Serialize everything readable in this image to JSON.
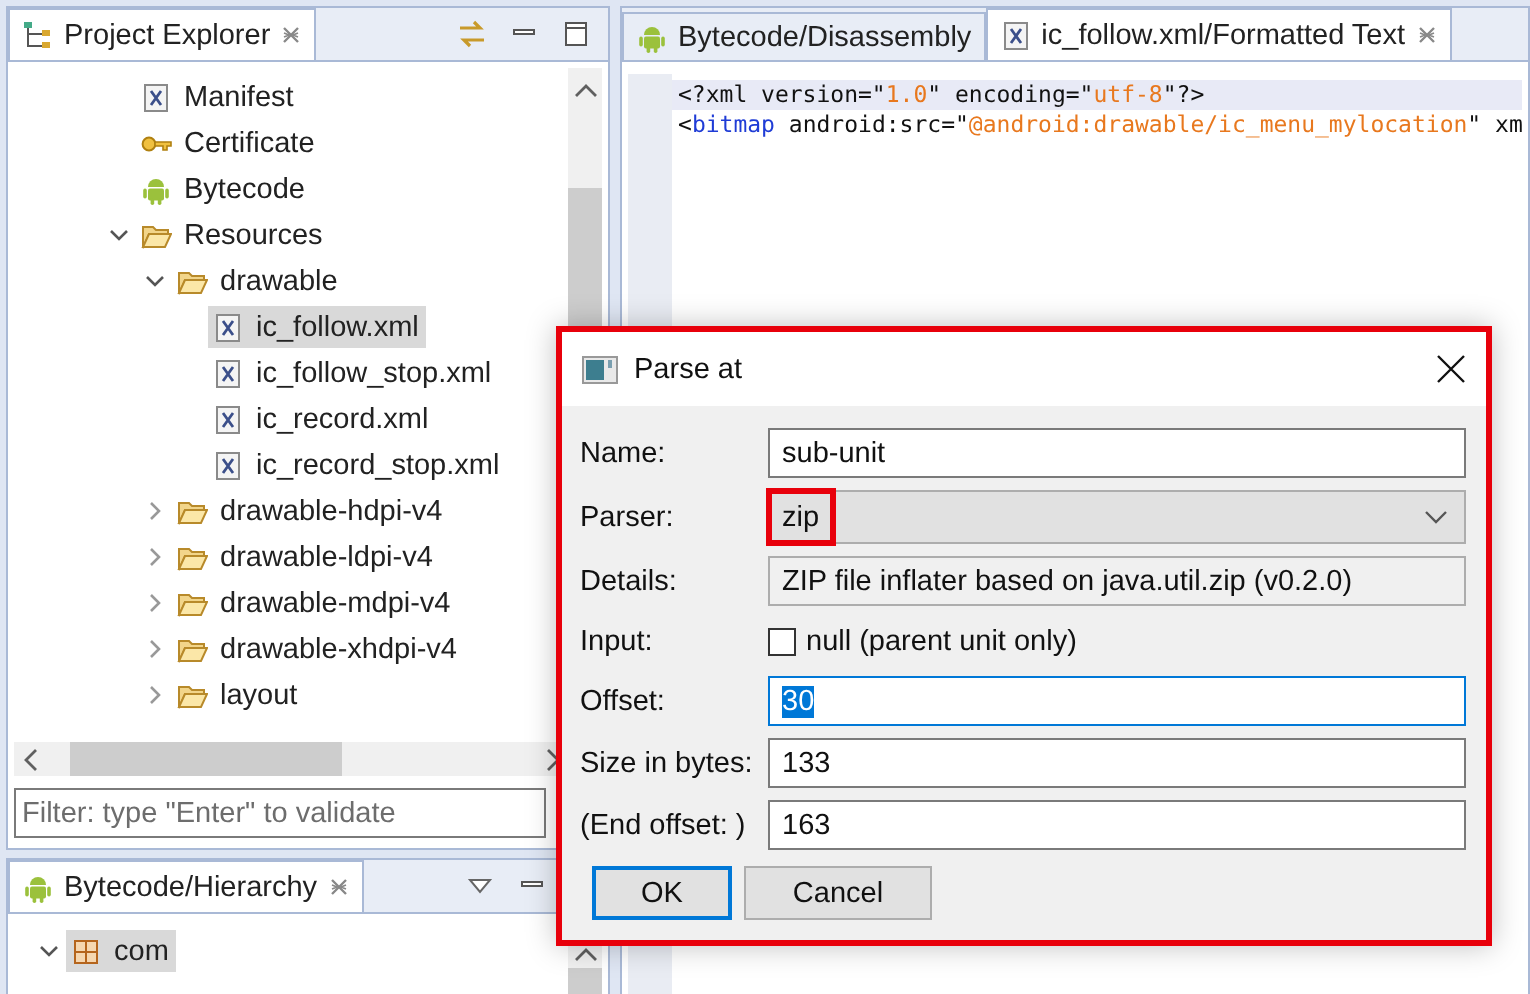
{
  "project_explorer": {
    "title": "Project Explorer",
    "tree": [
      {
        "label": "Manifest",
        "kind": "xml",
        "selected": false
      },
      {
        "label": "Certificate",
        "kind": "key",
        "selected": false
      },
      {
        "label": "Bytecode",
        "kind": "android",
        "selected": false
      },
      {
        "label": "Resources",
        "kind": "folder",
        "selected": false,
        "expanded": true,
        "children": [
          {
            "label": "drawable",
            "kind": "folder",
            "selected": false,
            "expanded": true,
            "children": [
              {
                "label": "ic_follow.xml",
                "kind": "xml",
                "selected": true
              },
              {
                "label": "ic_follow_stop.xml",
                "kind": "xml",
                "selected": false
              },
              {
                "label": "ic_record.xml",
                "kind": "xml",
                "selected": false
              },
              {
                "label": "ic_record_stop.xml",
                "kind": "xml",
                "selected": false
              }
            ]
          },
          {
            "label": "drawable-hdpi-v4",
            "kind": "folder",
            "selected": false,
            "expanded": false
          },
          {
            "label": "drawable-ldpi-v4",
            "kind": "folder",
            "selected": false,
            "expanded": false
          },
          {
            "label": "drawable-mdpi-v4",
            "kind": "folder",
            "selected": false,
            "expanded": false
          },
          {
            "label": "drawable-xhdpi-v4",
            "kind": "folder",
            "selected": false,
            "expanded": false
          },
          {
            "label": "layout",
            "kind": "folder",
            "selected": false,
            "expanded": false
          }
        ]
      }
    ],
    "filter": {
      "placeholder": "Filter: type \"Enter\" to validate"
    }
  },
  "hierarchy": {
    "title": "Bytecode/Hierarchy",
    "tree": [
      {
        "label": "com",
        "kind": "package",
        "selected": true,
        "expanded": true
      }
    ]
  },
  "editor": {
    "tabs": [
      {
        "label": "Bytecode/Disassembly",
        "kind": "android",
        "selected": false
      },
      {
        "label": "ic_follow.xml/Formatted Text",
        "kind": "xml",
        "selected": true
      }
    ],
    "lines": [
      {
        "current": true,
        "tokens": [
          {
            "kind": "plain",
            "text": "<?xml version=\""
          },
          {
            "kind": "string",
            "text": "1.0"
          },
          {
            "kind": "plain",
            "text": "\" encoding=\""
          },
          {
            "kind": "string",
            "text": "utf-8"
          },
          {
            "kind": "plain",
            "text": "\"?>"
          }
        ]
      },
      {
        "current": false,
        "tokens": [
          {
            "kind": "plain",
            "text": "<"
          },
          {
            "kind": "tag",
            "text": "bitmap"
          },
          {
            "kind": "plain",
            "text": " android:src=\""
          },
          {
            "kind": "string",
            "text": "@android:drawable/ic_menu_mylocation"
          },
          {
            "kind": "plain",
            "text": "\" xm"
          }
        ]
      }
    ]
  },
  "dialog": {
    "title": "Parse at",
    "rows": [
      {
        "label": "Name:",
        "kind": "text",
        "value": "sub-unit",
        "focused": false
      },
      {
        "label": "Parser:",
        "kind": "combo",
        "value": "zip",
        "annotated": true
      },
      {
        "label": "Details:",
        "kind": "readonly",
        "value": "ZIP file inflater based on java.util.zip (v0.2.0)"
      },
      {
        "label": "Input:",
        "kind": "checkbox",
        "value": "null (parent unit only)",
        "checked": false
      },
      {
        "label": "Offset:",
        "kind": "text",
        "value": "30",
        "focused": true
      },
      {
        "label": "Size in bytes:",
        "kind": "text",
        "value": "133",
        "focused": false
      },
      {
        "label": "(End offset: )",
        "kind": "text",
        "value": "163",
        "focused": false
      }
    ],
    "buttons": [
      {
        "label": "OK",
        "default": true
      },
      {
        "label": "Cancel",
        "default": false
      }
    ]
  }
}
